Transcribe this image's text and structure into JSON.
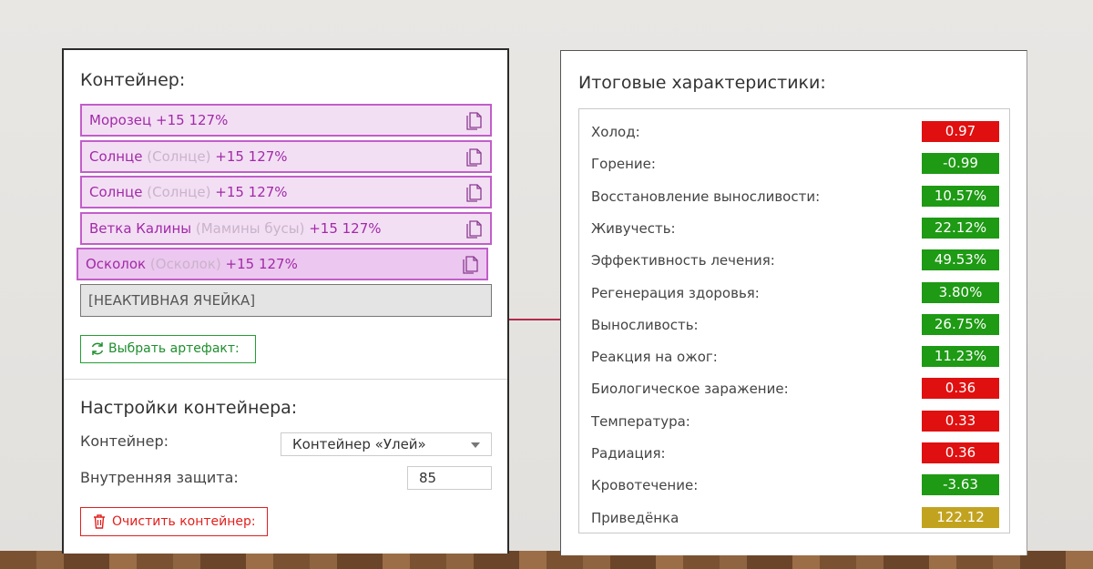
{
  "left": {
    "heading": "Контейнер:",
    "slots": [
      {
        "name": "Морозец",
        "source": "",
        "bonus": "+15 127%",
        "icon": "copy-icon"
      },
      {
        "name": "Солнце",
        "source": "(Солнце)",
        "bonus": "+15 127%",
        "icon": "copy-icon"
      },
      {
        "name": "Солнце",
        "source": "(Солнце)",
        "bonus": "+15 127%",
        "icon": "copy-icon"
      },
      {
        "name": "Ветка Калины",
        "source": "(Мамины бусы)",
        "bonus": "+15 127%",
        "icon": "copy-icon"
      },
      {
        "name": "Осколок",
        "source": "(Осколок)",
        "bonus": "+15 127%",
        "icon": "copy-icon"
      }
    ],
    "inactive_slot": "[НЕАКТИВНАЯ ЯЧЕЙКА]",
    "choose_button": "Выбрать артефакт:",
    "settings_heading": "Настройки контейнера:",
    "container_label": "Контейнер:",
    "container_value": "Контейнер «Улей»",
    "protection_label": "Внутренняя защита:",
    "protection_value": "85",
    "clear_button": "Очистить контейнер:"
  },
  "right": {
    "heading": "Итоговые характеристики:",
    "stats": [
      {
        "name": "Холод:",
        "value": "0.97",
        "color": "#e01010"
      },
      {
        "name": "Горение:",
        "value": "-0.99",
        "color": "#1e9a14"
      },
      {
        "name": "Восстановление выносливости:",
        "value": "10.57%",
        "color": "#1e9a14"
      },
      {
        "name": "Живучесть:",
        "value": "22.12%",
        "color": "#1e9a14"
      },
      {
        "name": "Эффективность лечения:",
        "value": "49.53%",
        "color": "#1e9a14"
      },
      {
        "name": "Регенерация здоровья:",
        "value": "3.80%",
        "color": "#1e9a14"
      },
      {
        "name": "Выносливость:",
        "value": "26.75%",
        "color": "#1e9a14"
      },
      {
        "name": "Реакция на ожог:",
        "value": "11.23%",
        "color": "#1e9a14"
      },
      {
        "name": "Биологическое заражение:",
        "value": "0.36",
        "color": "#e01010"
      },
      {
        "name": "Температура:",
        "value": "0.33",
        "color": "#e01010"
      },
      {
        "name": "Радиация:",
        "value": "0.36",
        "color": "#e01010"
      },
      {
        "name": "Кровотечение:",
        "value": "-3.63",
        "color": "#1e9a14"
      },
      {
        "name": "Приведёнка",
        "value": "122.12",
        "color": "#c2a320"
      }
    ]
  }
}
